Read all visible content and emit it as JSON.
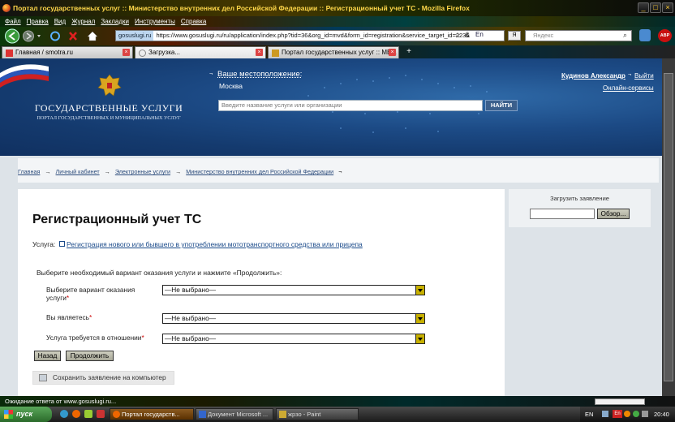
{
  "window": {
    "title": "Портал государственных услуг :: Министерство внутренних дел Российской Федерации :: Регистрационный учет ТС - Mozilla Firefox"
  },
  "menu": [
    "Файл",
    "Правка",
    "Вид",
    "Журнал",
    "Закладки",
    "Инструменты",
    "Справка"
  ],
  "nav": {
    "site_label": "gosuslugi.ru",
    "url": "https://www.gosuslugi.ru/ru/application/index.php?tid=36&org_id=mvd&form_id=registration&service_target_id=2236",
    "search_placeholder": "Яндекс"
  },
  "tabs": [
    {
      "label": "Главная / smotra.ru",
      "active": false
    },
    {
      "label": "Загрузка...",
      "active": true
    },
    {
      "label": "Портал государственных услуг :: МВ...",
      "active": false
    }
  ],
  "header": {
    "brand_title": "ГОСУДАРСТВЕННЫЕ УСЛУГИ",
    "brand_subtitle": "ПОРТАЛ ГОСУДАРСТВЕННЫХ И МУНИЦИПАЛЬНЫХ УСЛУГ",
    "location_label": "Ваше местоположение:",
    "location_city": "Москва",
    "search_placeholder": "Введите название услуги или организации",
    "search_button": "НАЙТИ",
    "user_name": "Кудинов Александр",
    "logout": "Выйти",
    "online_services": "Онлайн-сервисы"
  },
  "breadcrumb": [
    "Главная",
    "Личный кабинет",
    "Электронные услуги",
    "Министерство внутренних дел Российской Федерации"
  ],
  "main": {
    "title": "Регистрационный учет ТС",
    "service_label": "Услуга:",
    "service_link": "Регистрация нового или бывшего в употреблении мототранспортного средства или прицепа",
    "instructions": "Выберите необходимый вариант оказания услуги и нажмите «Продолжить»:",
    "fields": [
      {
        "label_line1": "Выберите вариант оказания",
        "label_line2": "услуги",
        "required": "*",
        "value": "—Не выбрано—"
      },
      {
        "label": "Вы являетесь",
        "required": "*",
        "value": "—Не выбрано—"
      },
      {
        "label": "Услуга требуется в отношении",
        "required": "*",
        "value": "—Не выбрано—"
      }
    ],
    "back_button": "Назад",
    "continue_button": "Продолжить",
    "save_draft": "Сохранить заявление на компьютер"
  },
  "sidebar": {
    "upload_title": "Загрузить заявление",
    "browse_button": "Обзор..."
  },
  "status": {
    "text": "Ожидание ответа от www.gosuslugi.ru..."
  },
  "taskbar": {
    "start": "пуск",
    "tasks": [
      "Портал государств...",
      "Документ Microsoft ...",
      "жрзо - Paint"
    ],
    "lang": "EN",
    "tray_lang": "En",
    "clock": "20:40"
  },
  "colors": {
    "header_blue": "#1c4a85",
    "link": "#1a4a8a",
    "required": "#cc0000",
    "select_arrow": "#c7b000"
  }
}
